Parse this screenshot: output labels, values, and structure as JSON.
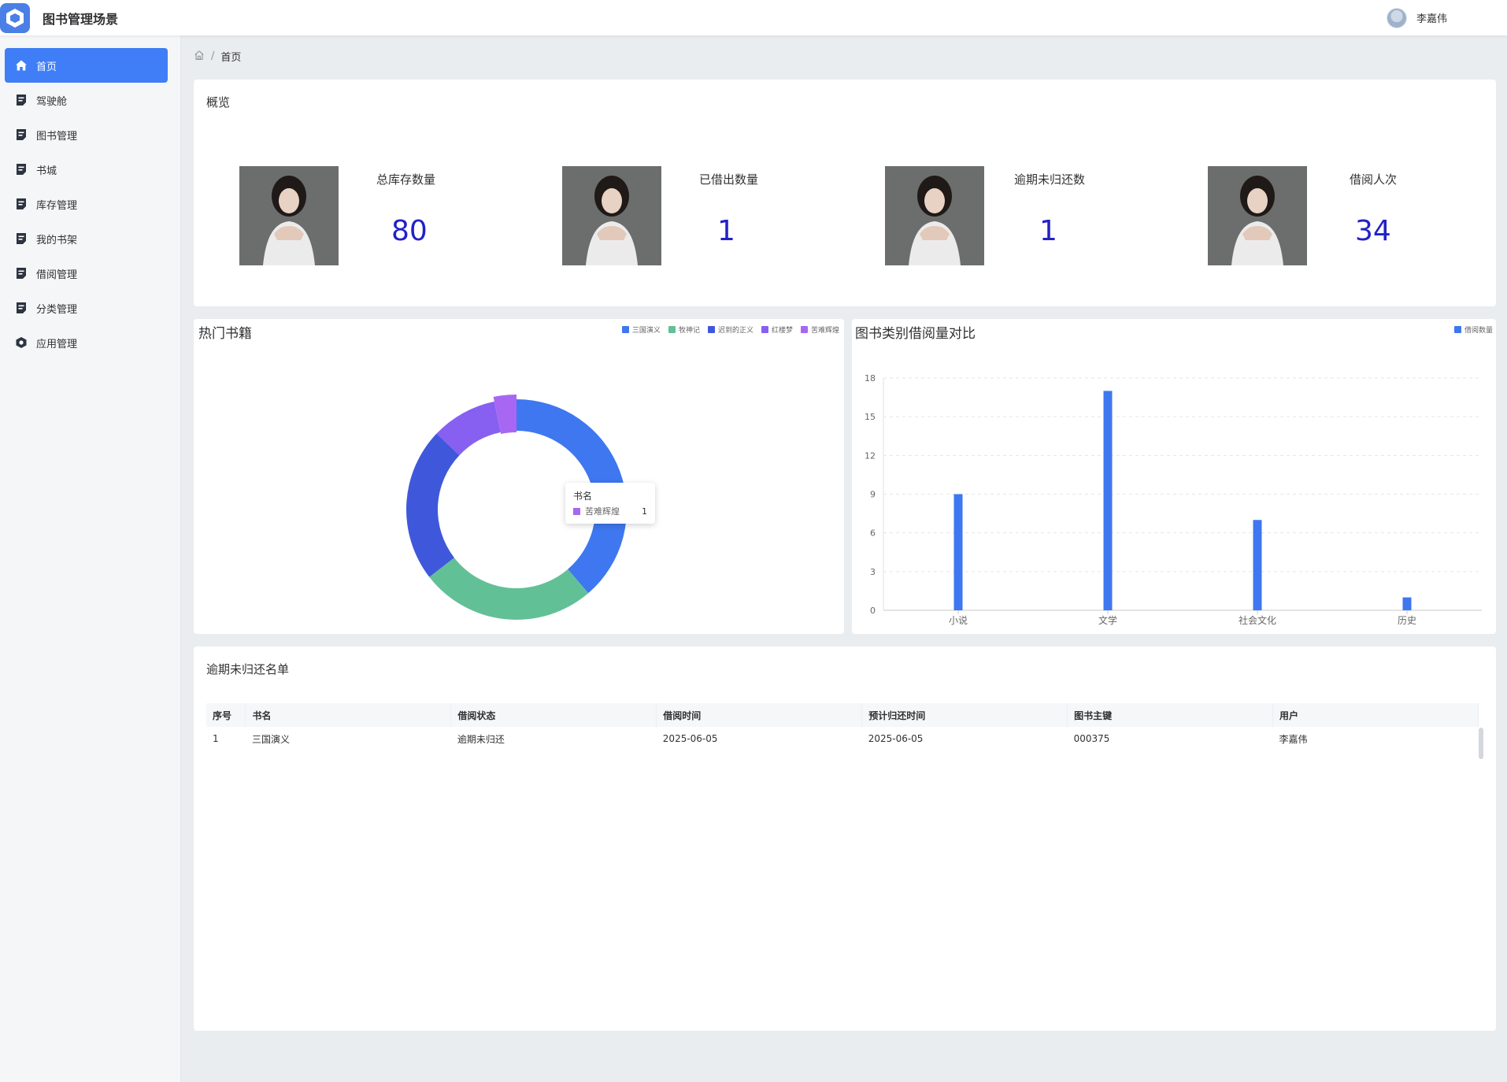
{
  "app": {
    "title": "图书管理场景",
    "user_name": "李嘉伟"
  },
  "sidebar": {
    "items": [
      {
        "label": "首页",
        "icon": "home-icon",
        "active": true
      },
      {
        "label": "驾驶舱",
        "icon": "document-icon"
      },
      {
        "label": "图书管理",
        "icon": "document-icon"
      },
      {
        "label": "书城",
        "icon": "document-icon"
      },
      {
        "label": "库存管理",
        "icon": "document-icon"
      },
      {
        "label": "我的书架",
        "icon": "document-icon"
      },
      {
        "label": "借阅管理",
        "icon": "document-icon"
      },
      {
        "label": "分类管理",
        "icon": "document-icon"
      },
      {
        "label": "应用管理",
        "icon": "app-icon"
      }
    ]
  },
  "breadcrumb": {
    "current": "首页",
    "separator": "/"
  },
  "overview": {
    "title": "概览",
    "stats": [
      {
        "label": "总库存数量",
        "value": "80"
      },
      {
        "label": "已借出数量",
        "value": "1"
      },
      {
        "label": "逾期未归还数",
        "value": "1"
      },
      {
        "label": "借阅人次",
        "value": "34"
      }
    ]
  },
  "hot_books": {
    "title": "热门书籍",
    "tooltip": {
      "title": "书名",
      "name": "苦难辉煌",
      "value": "1"
    }
  },
  "category_compare": {
    "title": "图书类别借阅量对比"
  },
  "overdue": {
    "title": "逾期未归还名单",
    "columns": [
      "序号",
      "书名",
      "借阅状态",
      "借阅时间",
      "预计归还时间",
      "图书主键",
      "用户"
    ],
    "rows": [
      [
        "1",
        "三国演义",
        "逾期未归还",
        "2025-06-05",
        "2025-06-05",
        "000375",
        "李嘉伟"
      ]
    ]
  },
  "colors": {
    "accent": "#3f7ef6",
    "stat_value": "#2121c8",
    "bar": "#3e77f0"
  },
  "chart_data": [
    {
      "type": "pie",
      "donut": true,
      "legend_position": "top-right",
      "series": [
        {
          "name": "书名",
          "data": [
            {
              "name": "三国演义",
              "value": 12,
              "color": "#3e77f0"
            },
            {
              "name": "牧神记",
              "value": 8,
              "color": "#62c096"
            },
            {
              "name": "迟到的正义",
              "value": 7,
              "color": "#3f58db"
            },
            {
              "name": "红楼梦",
              "value": 3,
              "color": "#8760f2"
            },
            {
              "name": "苦难辉煌",
              "value": 1,
              "color": "#a867f2"
            }
          ]
        }
      ]
    },
    {
      "type": "bar",
      "categories": [
        "小说",
        "文学",
        "社会文化",
        "历史"
      ],
      "series": [
        {
          "name": "借阅数量",
          "values": [
            9,
            17,
            7,
            1
          ]
        }
      ],
      "ylim": [
        0,
        18
      ],
      "yticks": [
        0,
        3,
        6,
        9,
        12,
        15,
        18
      ],
      "grid": true,
      "legend_position": "top-right"
    }
  ]
}
